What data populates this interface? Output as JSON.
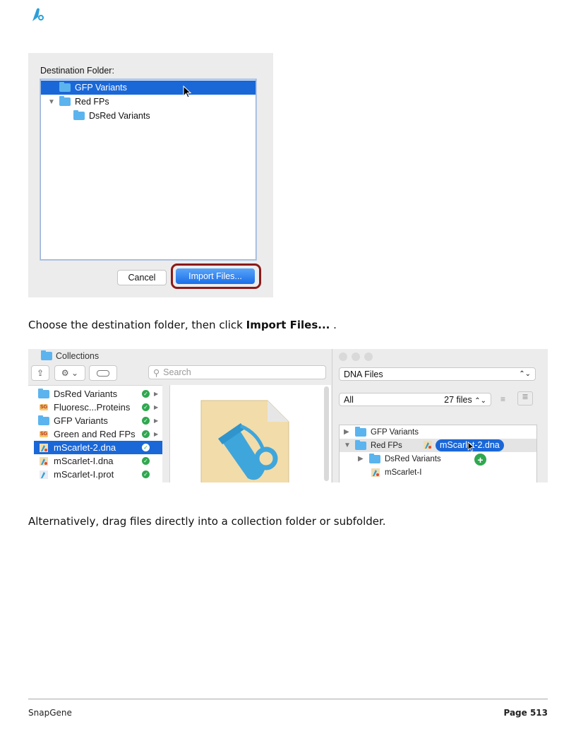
{
  "dialog": {
    "label": "Destination Folder:",
    "tree": [
      {
        "label": "GFP Variants",
        "selected": true
      },
      {
        "label": "Red FPs",
        "expanded": true
      },
      {
        "label": "DsRed Variants"
      }
    ],
    "cancel_label": "Cancel",
    "import_label": "Import Files..."
  },
  "caption1": {
    "before": "Choose the destination folder, then click ",
    "bold": "Import Files...",
    "after": " ."
  },
  "collections": {
    "title": "Collections",
    "search_placeholder": "Search",
    "items": [
      {
        "label": "DsRed Variants",
        "icon": "folder-icon",
        "status": "check",
        "arrow": true
      },
      {
        "label": "Fluoresc...Proteins",
        "icon": "sg-collection-icon",
        "icon_text": "SG",
        "status": "check",
        "arrow": true
      },
      {
        "label": "GFP Variants",
        "icon": "folder-icon",
        "status": "check",
        "arrow": true
      },
      {
        "label": "Green and Red FPs",
        "icon": "sg-collection-icon",
        "icon_text": "SG",
        "status": "check",
        "arrow": true
      },
      {
        "label": "mScarlet-2.dna",
        "icon": "dna-file-icon",
        "status": "check",
        "selected": true
      },
      {
        "label": "mScarlet-I.dna",
        "icon": "dna-file-icon",
        "status": "check"
      },
      {
        "label": "mScarlet-I.prot",
        "icon": "protein-file-icon",
        "status": "check"
      }
    ],
    "right": {
      "dropdown": "DNA Files",
      "filter": "All",
      "count": "27 files",
      "tree": [
        {
          "label": "GFP Variants",
          "expanded": false
        },
        {
          "label": "Red FPs",
          "expanded": true
        },
        {
          "label": "DsRed Variants",
          "expanded": false
        },
        {
          "label": "mScarlet-I"
        }
      ],
      "drag_label": "mScarlet-2.dna"
    }
  },
  "caption2": "Alternatively, drag files directly into a collection folder or subfolder.",
  "footer": {
    "left": "SnapGene",
    "right": "Page 513"
  }
}
